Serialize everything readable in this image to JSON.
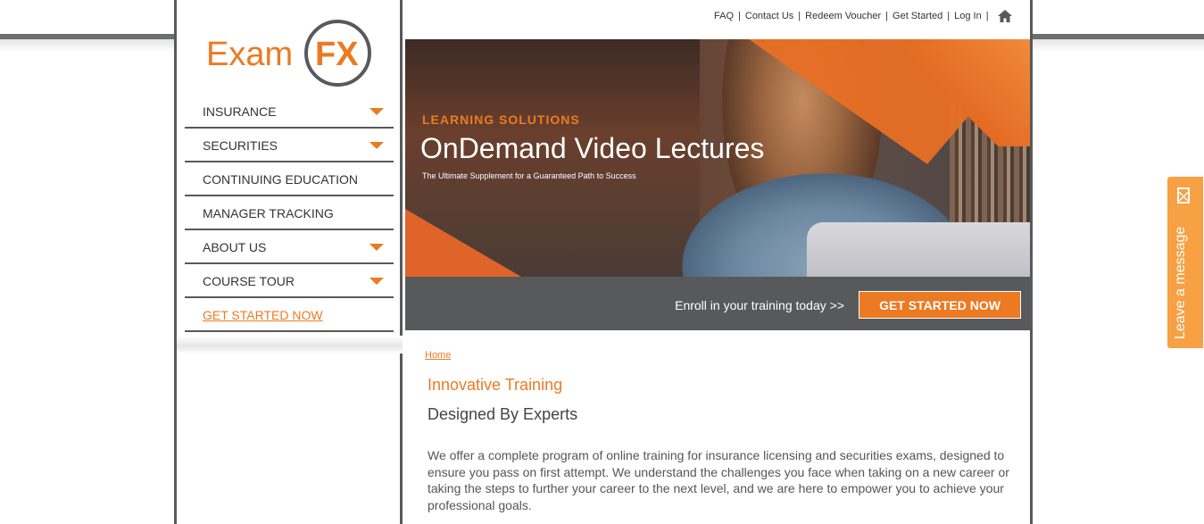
{
  "logo": {
    "text_left": "Exam",
    "text_right": "FX"
  },
  "nav": {
    "items": [
      {
        "label": "INSURANCE",
        "has_dropdown": true
      },
      {
        "label": "SECURITIES",
        "has_dropdown": true
      },
      {
        "label": "CONTINUING EDUCATION",
        "has_dropdown": false
      },
      {
        "label": "MANAGER TRACKING",
        "has_dropdown": false
      },
      {
        "label": "ABOUT US",
        "has_dropdown": true
      },
      {
        "label": "COURSE TOUR",
        "has_dropdown": true
      },
      {
        "label": "GET STARTED NOW",
        "has_dropdown": false
      }
    ]
  },
  "toplinks": {
    "faq": "FAQ",
    "contact": "Contact Us",
    "redeem": "Redeem Voucher",
    "get_started": "Get Started",
    "login": "Log In",
    "separator": "|",
    "home_icon": "home-icon"
  },
  "hero": {
    "eyebrow": "LEARNING SOLUTIONS",
    "title": "OnDemand Video Lectures",
    "subtitle": "The Ultimate Supplement for a Guaranteed Path to Success"
  },
  "enroll": {
    "text": "Enroll in your training today >>",
    "button": "GET STARTED NOW"
  },
  "content": {
    "breadcrumb": "Home",
    "heading": "Innovative Training",
    "subheading": "Designed By Experts",
    "body": "We offer a complete program of online training for insurance licensing and securities exams, designed to ensure you pass on first attempt. We understand the challenges you face when taking on a new career or taking the steps to further your career to the next level, and we are here to empower you to achieve your professional goals."
  },
  "chat": {
    "label": "Leave a message",
    "icon": "envelope-icon"
  },
  "colors": {
    "accent": "#ec7a22",
    "dark": "#58595b",
    "chat": "#f7a044"
  }
}
